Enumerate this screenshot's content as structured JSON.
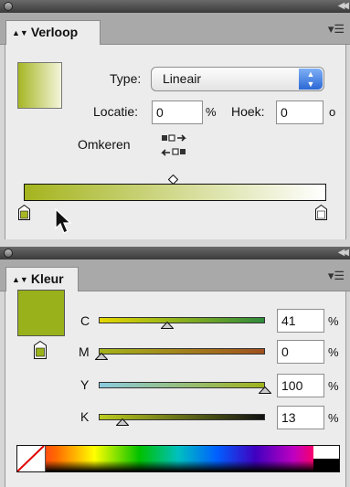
{
  "gradient_panel": {
    "tab_label": "Verloop",
    "type_label": "Type:",
    "type_value": "Lineair",
    "location_label": "Locatie:",
    "location_value": "0",
    "location_unit": "%",
    "angle_label": "Hoek:",
    "angle_value": "0",
    "angle_unit": "o",
    "reverse_label": "Omkeren",
    "start_color": "#a6b624",
    "end_color": "#ffffff"
  },
  "color_panel": {
    "tab_label": "Kleur",
    "fill_color": "#99b11a",
    "channels": [
      {
        "label": "C",
        "value": "41",
        "unit": "%"
      },
      {
        "label": "M",
        "value": "0",
        "unit": "%"
      },
      {
        "label": "Y",
        "value": "100",
        "unit": "%"
      },
      {
        "label": "K",
        "value": "13",
        "unit": "%"
      }
    ]
  },
  "icons": {
    "panel_collapse": "double-chevron-left-icon",
    "panel_menu": "panel-menu-icon",
    "reverse": "reverse-gradient-icon",
    "cursor": "mouse-pointer-icon"
  }
}
